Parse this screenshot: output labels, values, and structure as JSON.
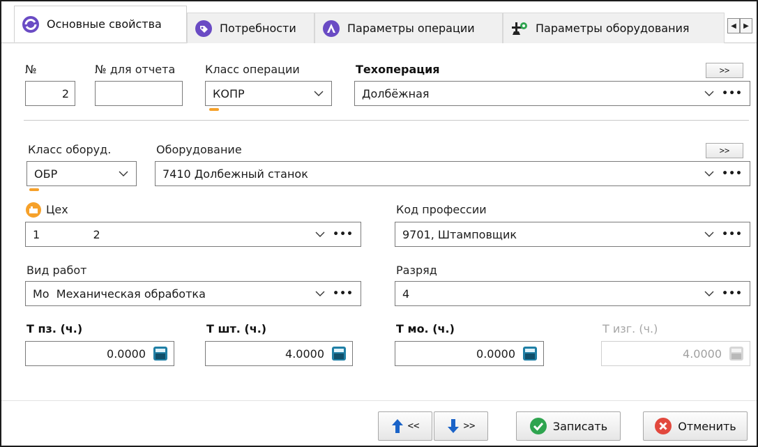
{
  "tabs": [
    {
      "label": "Основные свойства",
      "icon": "globe-swirl-icon",
      "active": true
    },
    {
      "label": "Потребности",
      "icon": "tag-icon",
      "active": false
    },
    {
      "label": "Параметры операции",
      "icon": "triangle-a-icon",
      "active": false
    },
    {
      "label": "Параметры оборудования",
      "icon": "machine-gear-icon",
      "active": false
    }
  ],
  "tab_scroll": {
    "left": "◀",
    "right": "▶"
  },
  "operation": {
    "num_label": "№",
    "num_value": "2",
    "report_num_label": "№ для отчета",
    "report_num_value": "",
    "op_class_label": "Класс операции",
    "op_class_value": "КОПР",
    "techop_label": "Техоперация",
    "techop_value": "Долбёжная",
    "techop_more": ">>"
  },
  "equipment": {
    "eq_class_label": "Класс оборуд.",
    "eq_class_value": "ОБР",
    "eq_label": "Оборудование",
    "eq_value": "7410  Долбежный станок",
    "eq_more": ">>"
  },
  "workshop": {
    "label": "Цех",
    "value": "1               2"
  },
  "profession": {
    "label": "Код профессии",
    "value": "9701, Штамповщик"
  },
  "work_type": {
    "label": "Вид работ",
    "value": "Мо  Механическая обработка"
  },
  "grade": {
    "label": "Разряд",
    "value": "4"
  },
  "times": {
    "tpz_label": "Т пз. (ч.)",
    "tpz_value": "0.0000",
    "tsht_label": "Т шт. (ч.)",
    "tsht_value": "4.0000",
    "tmo_label": "Т мо. (ч.)",
    "tmo_value": "0.0000",
    "tizg_label": "Т изг. (ч.)",
    "tizg_value": "4.0000"
  },
  "footer": {
    "prev_label": "<<",
    "next_label": ">>",
    "save_label": "Записать",
    "cancel_label": "Отменить"
  },
  "colors": {
    "accent_purple": "#6a4bc4",
    "save_green": "#2ea44f",
    "cancel_red": "#e2483d",
    "calc_teal": "#1f7fa5",
    "marker_orange": "#f6a12a",
    "nav_blue": "#1a63c8"
  }
}
